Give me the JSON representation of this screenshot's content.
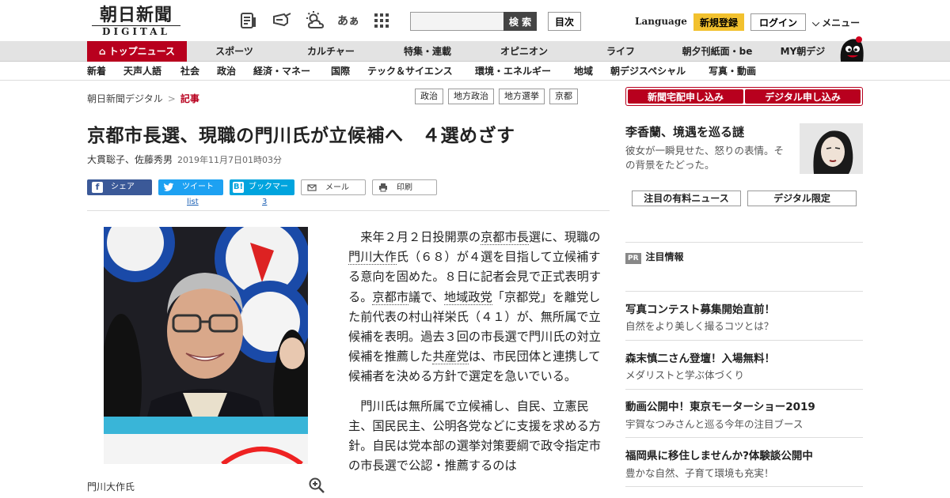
{
  "header": {
    "logo_jp": "朝日新聞",
    "logo_en": "DIGITAL",
    "icons": [
      "newspaper-icon",
      "megaphone-icon",
      "weather-icon",
      "font-size-icon",
      "grid-menu-icon"
    ],
    "font_icon_glyph": "あぁ",
    "search_placeholder": "",
    "search_label": "検 索",
    "toc_label": "目次",
    "language_label": "Language",
    "register_label": "新規登録",
    "login_label": "ログイン",
    "menu_label": "メニュー"
  },
  "nav1": {
    "top_news": "トップニュース",
    "items": [
      "スポーツ",
      "カルチャー",
      "特集・連載",
      "オピニオン",
      "ライフ",
      "朝夕刊紙面・be",
      "MY朝デジ"
    ]
  },
  "nav2": {
    "items": [
      "新着",
      "天声人語",
      "社会",
      "政治",
      "経済・マネー",
      "国際",
      "テック＆サイエンス",
      "環境・エネルギー",
      "地域",
      "朝デジスペシャル",
      "写真・動画"
    ]
  },
  "breadcrumb": {
    "home": "朝日新聞デジタル",
    "separator": ">",
    "current": "記事"
  },
  "tags": [
    "政治",
    "地方政治",
    "地方選挙",
    "京都"
  ],
  "subscribe": {
    "paper": "新聞宅配申し込み",
    "digital": "デジタル申し込み"
  },
  "article": {
    "title": "京都市長選、現職の門川氏が立候補へ　４選めざす",
    "authors": "大貫聡子、佐藤秀男",
    "date": "2019年11月7日01時03分",
    "caption": "門川大作氏",
    "p1": {
      "a": "来年２月２日投開票の",
      "l1": "京都市長",
      "b": "選に、現職の",
      "l2": "門川大作",
      "c": "氏（６８）が４選を目指して立候補する意向を固めた。８日に記者会見で正式表明する。",
      "l3": "京都市",
      "d": "議で、",
      "l4": "地域政党",
      "e": "「京都党」を離党した前代表の村山祥栄氏（４１）が、無所属で立候補を表明。過去３回の市長選で門川氏の対立候補を推薦した",
      "l5": "共産党",
      "f": "は、市民団体と連携して候補者を決める方針で選定を急いでいる。"
    },
    "p2": "門川氏は無所属で立候補し、自民、立憲民主、国民民主、公明各党などに支援を求める方針。自民は党本部の選挙対策要綱で政令指定市の市長選で公認・推薦するのは"
  },
  "share": {
    "facebook": "シェア",
    "twitter": "ツイート",
    "twitter_count": "list",
    "hatena": "ブックマーク",
    "hatena_count": "3",
    "mail": "メール",
    "print": "印刷"
  },
  "sidebar": {
    "feature_title": "李香蘭、境遇を巡る謎",
    "feature_desc": "彼女が一瞬見せた、怒りの表情。その背景をたどった。",
    "btn_paid": "注目の有料ニュース",
    "btn_digital": "デジタル限定",
    "pr_badge": "PR",
    "pr_label": "注目情報",
    "promos": [
      {
        "title": "写真コンテスト募集開始直前！",
        "sub": "自然をより美しく撮るコツとは？"
      },
      {
        "title": "森末慎二さん登壇！入場無料！",
        "sub": "メダリストと学ぶ体づくり"
      },
      {
        "title": "動画公開中！東京モーターショー2019",
        "sub": "宇賀なつみさんと巡る今年の注目ブース"
      },
      {
        "title": "福岡県に移住しませんか?体験談公開中",
        "sub": "豊かな自然、子育て環境も充実！"
      }
    ]
  },
  "colors": {
    "brand_red": "#b8001e",
    "register_yellow": "#f2c12e",
    "facebook": "#3b5998",
    "twitter": "#1da1f2",
    "hatena": "#00a4de"
  }
}
